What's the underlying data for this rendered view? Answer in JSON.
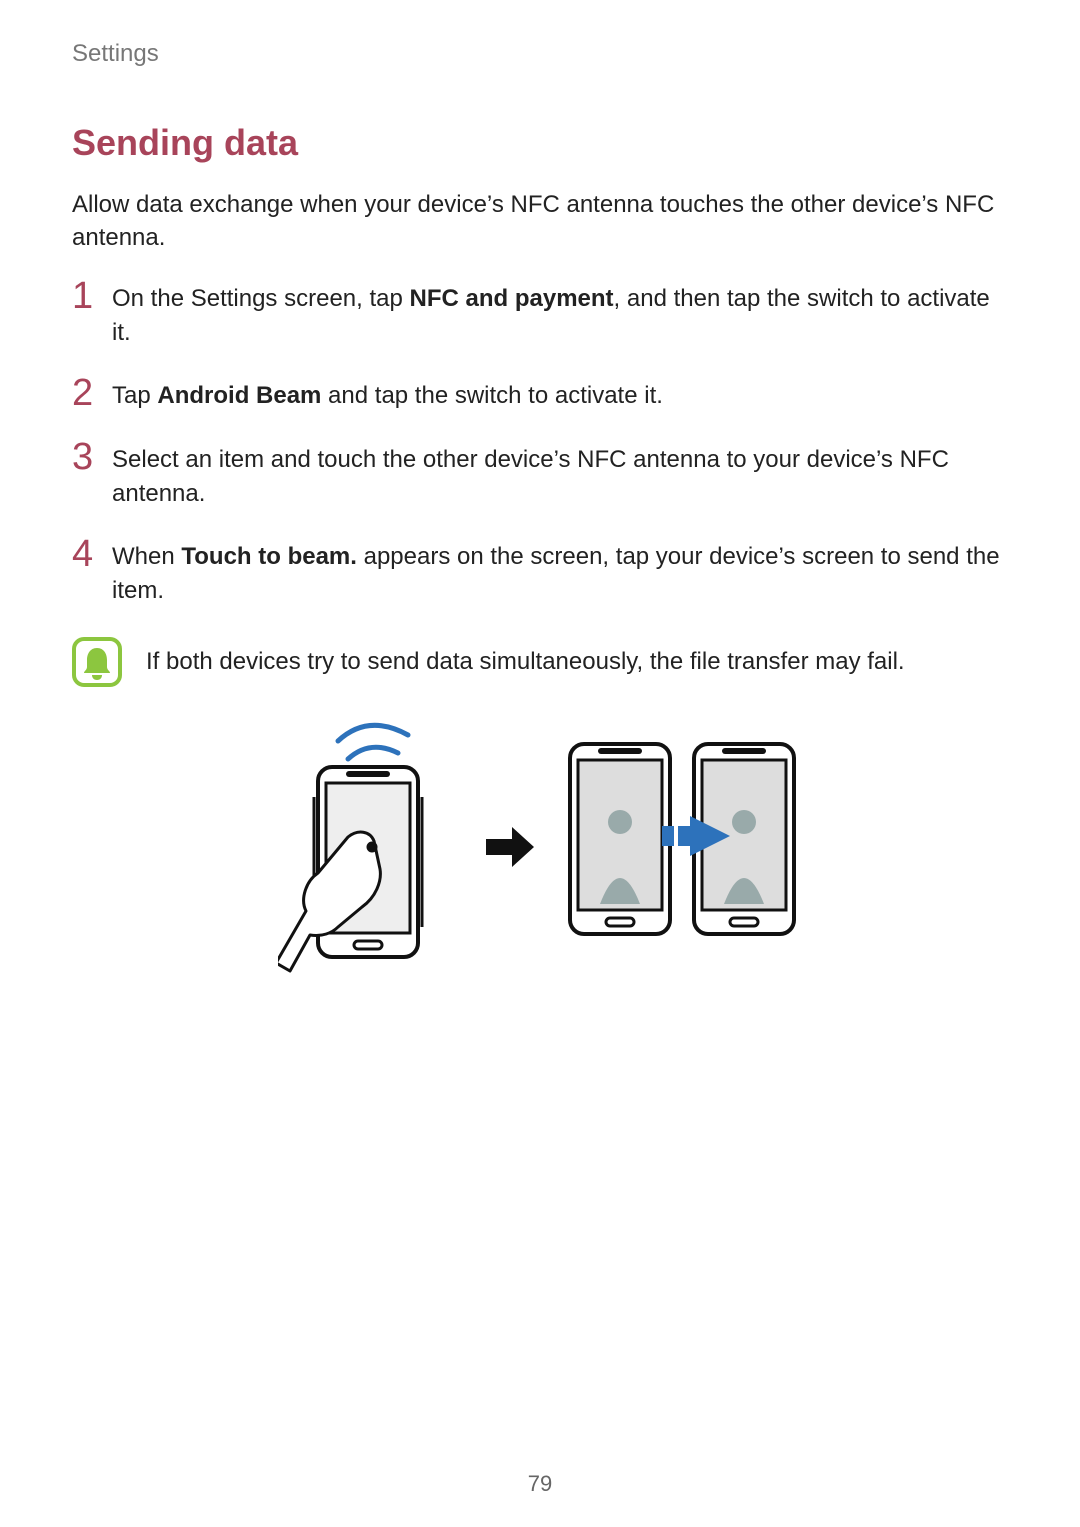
{
  "breadcrumb": "Settings",
  "section_title": "Sending data",
  "intro": "Allow data exchange when your device’s NFC antenna touches the other device’s NFC antenna.",
  "steps": {
    "s1": {
      "a": "On the Settings screen, tap ",
      "b": "NFC and payment",
      "c": ", and then tap the switch to activate it."
    },
    "s2": {
      "a": "Tap ",
      "b": "Android Beam",
      "c": " and tap the switch to activate it."
    },
    "s3": {
      "a": "Select an item and touch the other device’s NFC antenna to your device’s NFC antenna."
    },
    "s4": {
      "a": "When ",
      "b": "Touch to beam.",
      "c": " appears on the screen, tap your device’s screen to send the item."
    }
  },
  "note": "If both devices try to send data simultaneously, the file transfer may fail.",
  "page_number": "79"
}
